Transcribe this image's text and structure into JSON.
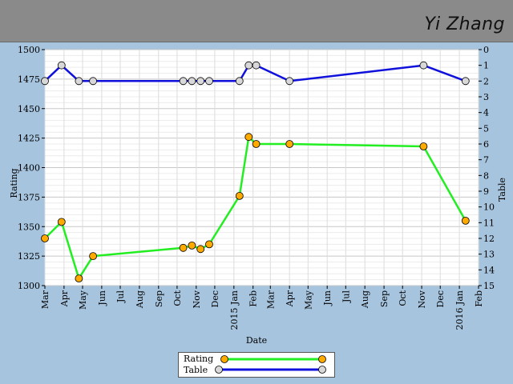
{
  "header": {
    "player_name": "Yi Zhang"
  },
  "chart_data": {
    "type": "line",
    "xlabel": "Date",
    "ylabel": "Rating",
    "y2label": "Table",
    "ylim": [
      1300,
      1500
    ],
    "y2lim": [
      15,
      0
    ],
    "xlim": [
      "2014-03-01",
      "2016-02-01"
    ],
    "yticks": [
      1300,
      1325,
      1350,
      1375,
      1400,
      1425,
      1450,
      1475,
      1500
    ],
    "y2ticks": [
      0,
      1,
      2,
      3,
      4,
      5,
      6,
      7,
      8,
      9,
      10,
      11,
      12,
      13,
      14,
      15
    ],
    "xticks": [
      {
        "date": "2014-03-01",
        "label": "Mar"
      },
      {
        "date": "2014-04-01",
        "label": "Apr"
      },
      {
        "date": "2014-05-01",
        "label": "May"
      },
      {
        "date": "2014-06-01",
        "label": "Jun"
      },
      {
        "date": "2014-07-01",
        "label": "Jul"
      },
      {
        "date": "2014-08-01",
        "label": "Aug"
      },
      {
        "date": "2014-09-01",
        "label": "Sep"
      },
      {
        "date": "2014-10-01",
        "label": "Oct"
      },
      {
        "date": "2014-11-01",
        "label": "Nov"
      },
      {
        "date": "2014-12-01",
        "label": "Dec"
      },
      {
        "date": "2015-01-01",
        "label": "2015 Jan"
      },
      {
        "date": "2015-02-01",
        "label": "Feb"
      },
      {
        "date": "2015-03-01",
        "label": "Mar"
      },
      {
        "date": "2015-04-01",
        "label": "Apr"
      },
      {
        "date": "2015-05-01",
        "label": "May"
      },
      {
        "date": "2015-06-01",
        "label": "Jun"
      },
      {
        "date": "2015-07-01",
        "label": "Jul"
      },
      {
        "date": "2015-08-01",
        "label": "Aug"
      },
      {
        "date": "2015-09-01",
        "label": "Sep"
      },
      {
        "date": "2015-10-01",
        "label": "Oct"
      },
      {
        "date": "2015-11-01",
        "label": "Nov"
      },
      {
        "date": "2015-12-01",
        "label": "Dec"
      },
      {
        "date": "2016-01-01",
        "label": "2016 Jan"
      },
      {
        "date": "2016-02-01",
        "label": "Feb"
      }
    ],
    "grid": true,
    "legend_position": "bottom-center",
    "series": [
      {
        "name": "Rating",
        "axis": "left",
        "line_color": "#22ee22",
        "marker_color": "#ffaa00",
        "points": [
          {
            "x": "2014-03-01",
            "y": 1340
          },
          {
            "x": "2014-03-28",
            "y": 1354
          },
          {
            "x": "2014-04-25",
            "y": 1306
          },
          {
            "x": "2014-05-18",
            "y": 1325
          },
          {
            "x": "2014-10-11",
            "y": 1332
          },
          {
            "x": "2014-10-25",
            "y": 1334
          },
          {
            "x": "2014-11-08",
            "y": 1331
          },
          {
            "x": "2014-11-22",
            "y": 1335
          },
          {
            "x": "2015-01-10",
            "y": 1376
          },
          {
            "x": "2015-01-25",
            "y": 1426
          },
          {
            "x": "2015-02-06",
            "y": 1420
          },
          {
            "x": "2015-04-01",
            "y": 1420
          },
          {
            "x": "2015-11-04",
            "y": 1418
          },
          {
            "x": "2016-01-11",
            "y": 1355
          }
        ]
      },
      {
        "name": "Table",
        "axis": "right",
        "line_color": "#1010dd",
        "marker_color": "#d8d8d8",
        "points": [
          {
            "x": "2014-03-01",
            "y": 2
          },
          {
            "x": "2014-03-28",
            "y": 1
          },
          {
            "x": "2014-04-25",
            "y": 2
          },
          {
            "x": "2014-05-18",
            "y": 2
          },
          {
            "x": "2014-10-11",
            "y": 2
          },
          {
            "x": "2014-10-25",
            "y": 2
          },
          {
            "x": "2014-11-08",
            "y": 2
          },
          {
            "x": "2014-11-22",
            "y": 2
          },
          {
            "x": "2015-01-10",
            "y": 2
          },
          {
            "x": "2015-01-25",
            "y": 1
          },
          {
            "x": "2015-02-06",
            "y": 1
          },
          {
            "x": "2015-04-01",
            "y": 2
          },
          {
            "x": "2015-11-04",
            "y": 1
          },
          {
            "x": "2016-01-11",
            "y": 2
          }
        ]
      }
    ]
  }
}
